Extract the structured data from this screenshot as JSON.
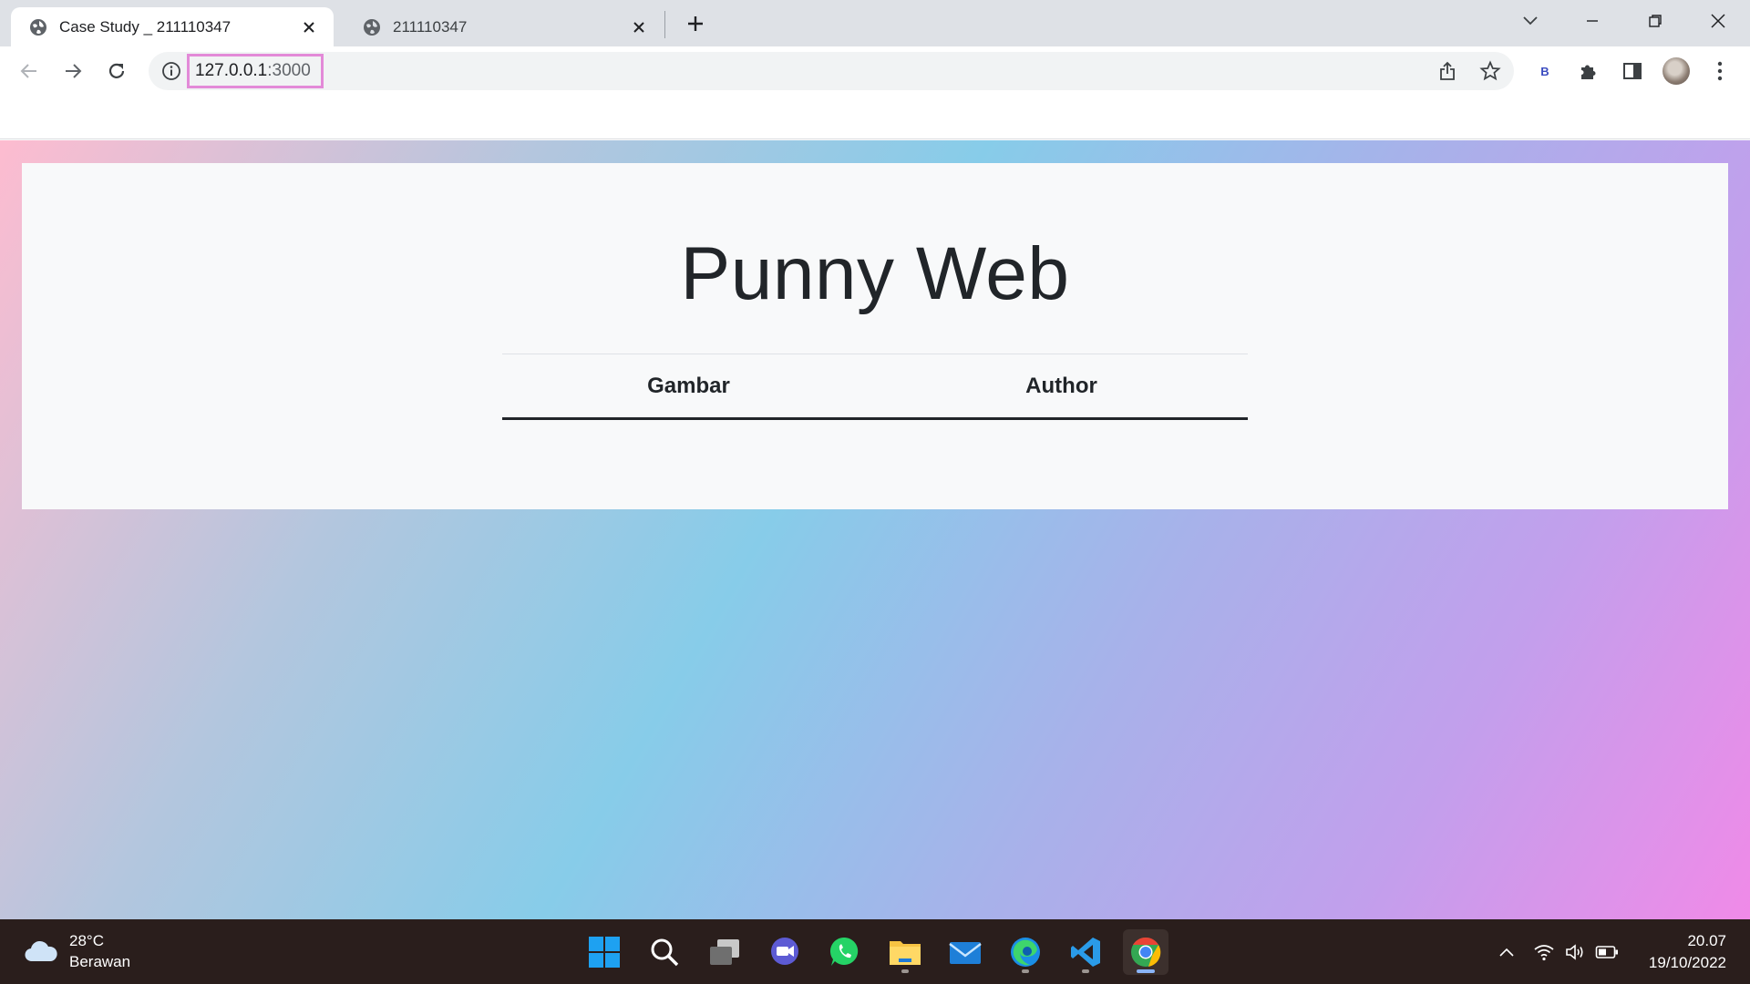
{
  "browser": {
    "tabs": [
      {
        "title": "Case Study _ 211110347"
      },
      {
        "title": "211110347"
      }
    ],
    "address": {
      "host": "127.0.0.1",
      "port": ":3000"
    },
    "extension_label": "B"
  },
  "page": {
    "heading": "Punny Web",
    "table_headers": [
      "Gambar",
      "Author"
    ]
  },
  "taskbar": {
    "weather": {
      "temperature": "28°C",
      "condition": "Berawan"
    },
    "clock": {
      "time": "20.07",
      "date": "19/10/2022"
    }
  },
  "colors": {
    "gradient": [
      "#fdbcd0",
      "#87cce9",
      "#a8b1ea",
      "#f08ae8"
    ],
    "url_highlight": "#e38ad8",
    "taskbar_bg": "#2a1e1c"
  }
}
